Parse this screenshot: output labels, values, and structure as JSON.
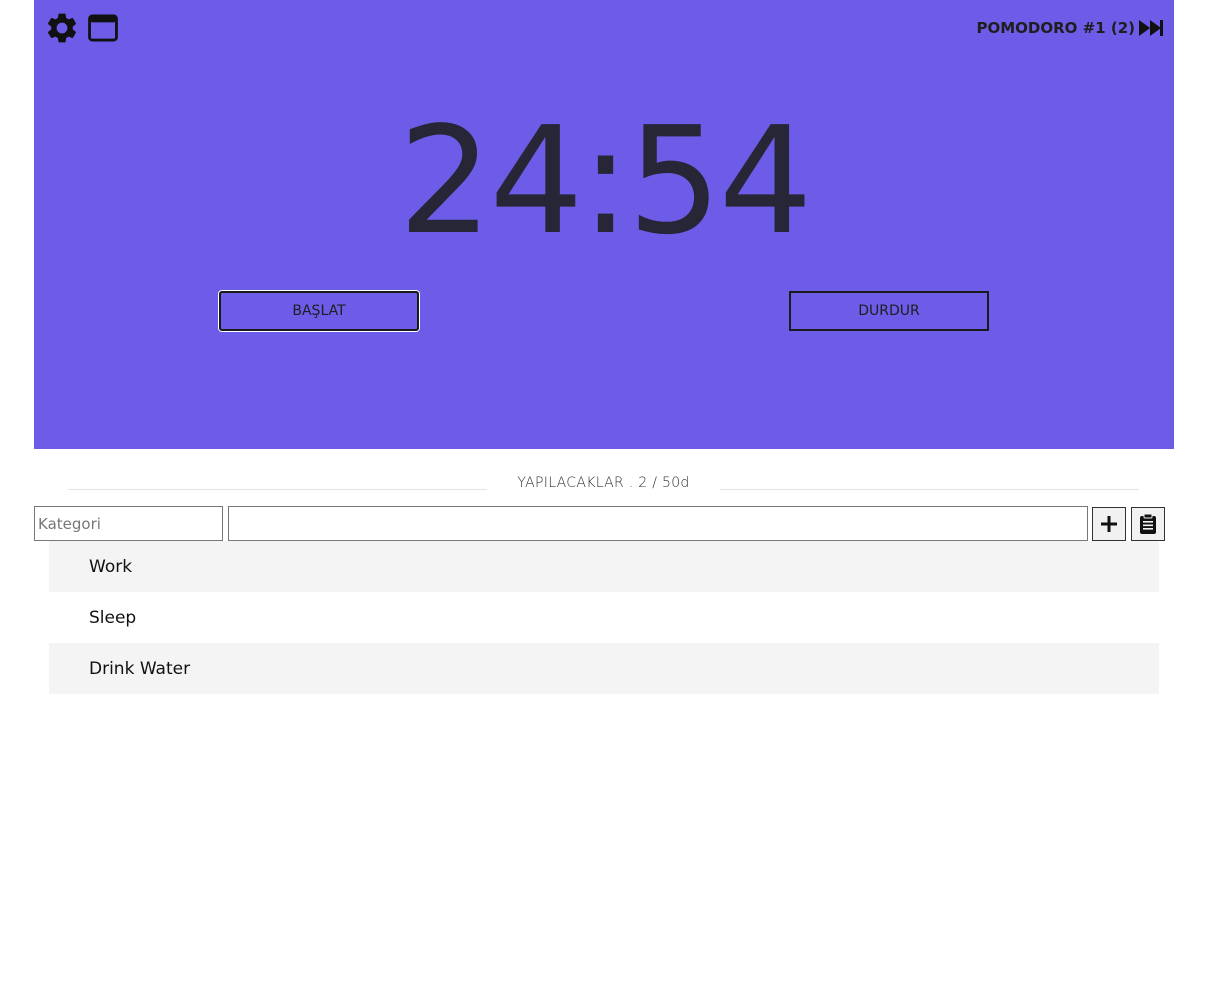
{
  "timer": {
    "mode_label": "POMODORO #1 (2)",
    "time": "24:54",
    "start_label": "BAŞLAT",
    "stop_label": "DURDUR"
  },
  "icons": {
    "settings": "gear-icon",
    "window": "window-icon",
    "skip": "fast-forward-icon",
    "add": "plus-icon",
    "paste": "clipboard-icon"
  },
  "todos": {
    "header": "YAPILACAKLAR . 2 / 50d",
    "category_placeholder": "Kategori",
    "task_value": "",
    "items": [
      {
        "label": "Work"
      },
      {
        "label": "Sleep"
      },
      {
        "label": "Drink Water"
      }
    ]
  },
  "colors": {
    "accent": "#6c5ce7",
    "row_alt": "#f4f4f4"
  }
}
